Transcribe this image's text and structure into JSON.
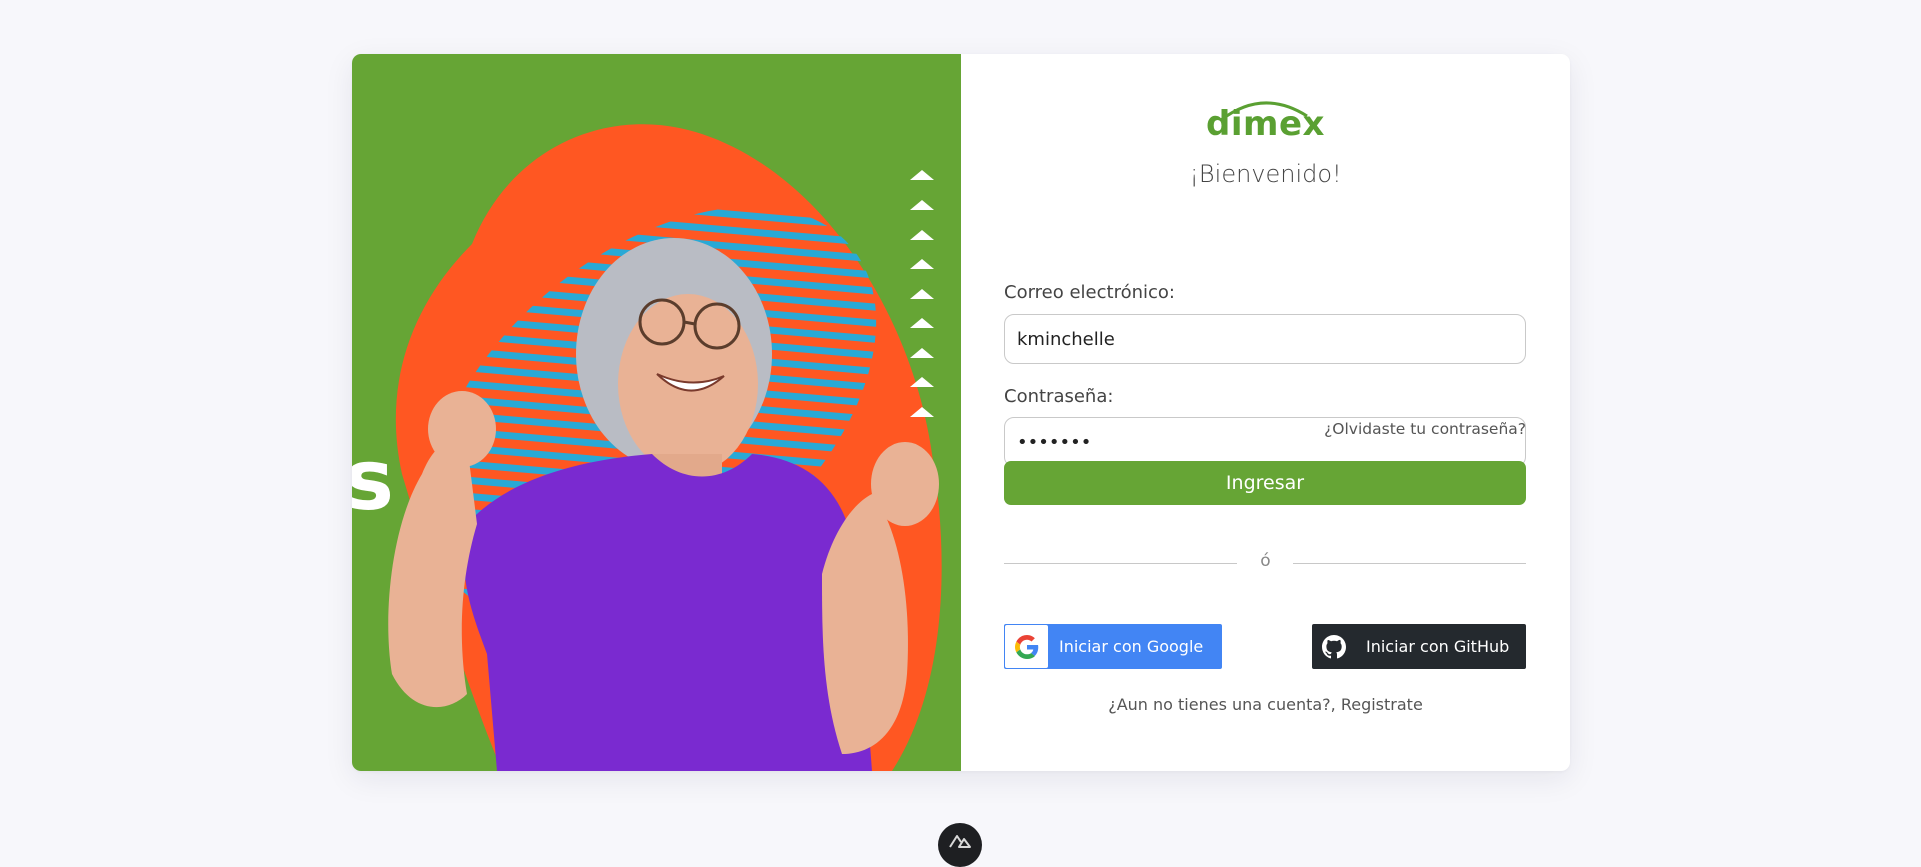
{
  "brand": {
    "logo_text": "dimex"
  },
  "hero": {
    "side_text": "s"
  },
  "form": {
    "welcome": "¡Bienvenido!",
    "email_label": "Correo electrónico:",
    "email_value": "kminchelle",
    "password_label": "Contraseña:",
    "password_value": "•••••••",
    "forgot_link": "¿Olvidaste tu contraseña?",
    "submit_label": "Ingresar",
    "divider_text": "ó",
    "google_label": "Iniciar con Google",
    "github_label": "Iniciar con GitHub",
    "register_prompt": "¿Aun no tienes una cuenta?, ",
    "register_link": "Registrate"
  },
  "colors": {
    "brand_green": "#66a535",
    "hero_orange": "#ff5722",
    "hero_stripes": "#29a9d6",
    "shirt_purple": "#7a2ad0",
    "google_blue": "#4285f4",
    "github_dark": "#24292e"
  },
  "icons": {
    "google": "google-icon",
    "github": "github-icon",
    "nuxt": "nuxt-icon",
    "arrows": "triangle-up-icon"
  }
}
